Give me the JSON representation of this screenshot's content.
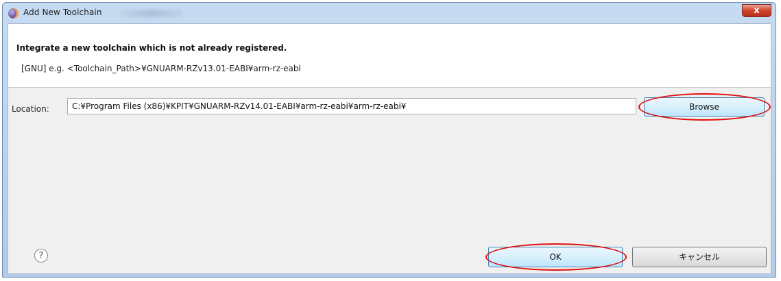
{
  "window": {
    "title": "Add New Toolchain",
    "close_glyph": "x",
    "title_icon": "eclipse-app-icon"
  },
  "header": {
    "title": "Integrate a new toolchain which is not already registered.",
    "description": "[GNU] e.g. <Toolchain_Path>¥GNUARM-RZv13.01-EABI¥arm-rz-eabi"
  },
  "form": {
    "location_label": "Location:",
    "location_value": "C:¥Program Files (x86)¥KPIT¥GNUARM-RZv14.01-EABI¥arm-rz-eabi¥arm-rz-eabi¥",
    "browse_label": "Browse"
  },
  "footer": {
    "help_glyph": "?",
    "ok_label": "OK",
    "cancel_label": "キャンセル"
  },
  "colors": {
    "highlight_ring": "#e01010",
    "window_frame": "#b3cbe8",
    "close_button": "#d0432c"
  }
}
